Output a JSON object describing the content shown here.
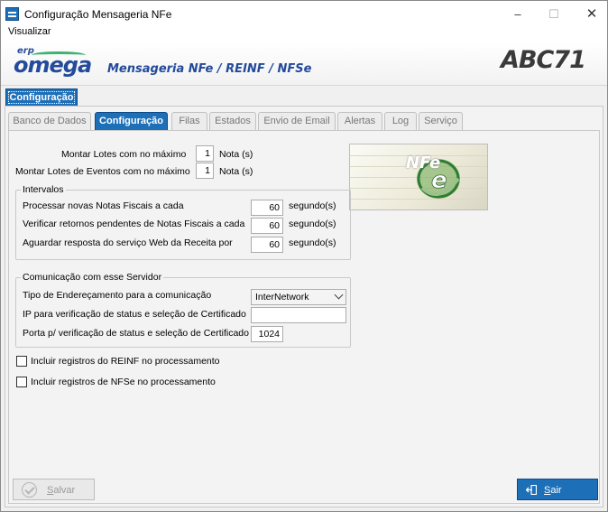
{
  "window": {
    "title": "Configuração Mensageria NFe",
    "controls": {
      "minimize": "–",
      "maximize": "☐",
      "close": "✕"
    }
  },
  "menu": {
    "items": [
      "Visualizar"
    ]
  },
  "banner": {
    "logo_prefix": "erp",
    "logo_name": "omega",
    "title": "Mensageria NFe / REINF / NFSe",
    "brand": "ABC71"
  },
  "outer_tab": {
    "label": "Configuração"
  },
  "tabs": [
    {
      "label": "Banco de Dados",
      "active": false
    },
    {
      "label": "Configuração",
      "active": true
    },
    {
      "label": "Filas",
      "active": false
    },
    {
      "label": "Estados",
      "active": false
    },
    {
      "label": "Envio de Email",
      "active": false
    },
    {
      "label": "Alertas",
      "active": false
    },
    {
      "label": "Log",
      "active": false
    },
    {
      "label": "Serviço",
      "active": false
    }
  ],
  "lotes": {
    "max_lotes_label": "Montar Lotes com no máximo",
    "max_lotes_value": "1",
    "max_lotes_unit": "Nota (s)",
    "max_lotes_eventos_label": "Montar Lotes de Eventos com no máximo",
    "max_lotes_eventos_value": "1",
    "max_lotes_eventos_unit": "Nota (s)"
  },
  "intervalos": {
    "title": "Intervalos",
    "rows": [
      {
        "label": "Processar novas Notas Fiscais a cada",
        "value": "60",
        "unit": "segundo(s)"
      },
      {
        "label": "Verificar retornos pendentes de Notas Fiscais a cada",
        "value": "60",
        "unit": "segundo(s)"
      },
      {
        "label": "Aguardar resposta do serviço Web da Receita por",
        "value": "60",
        "unit": "segundo(s)"
      }
    ]
  },
  "comunicacao": {
    "title": "Comunicação com esse Servidor",
    "tipo_label": "Tipo de Endereçamento para a comunicação",
    "tipo_value": "InterNetwork",
    "ip_label": "IP para verificação de status e seleção de Certificado",
    "ip_value": "",
    "porta_label": "Porta p/ verificação de status e seleção de Certificado",
    "porta_value": "1024"
  },
  "options": {
    "reinf_label": "Incluir registros do REINF no processamento",
    "reinf_checked": false,
    "nfse_label": "Incluir registros de NFSe no processamento",
    "nfse_checked": false
  },
  "nfe_image": {
    "text": "NFe"
  },
  "buttons": {
    "salvar_prefix": "S",
    "salvar_rest": "alvar",
    "salvar_enabled": false,
    "sair_prefix": "S",
    "sair_rest": "air"
  },
  "colors": {
    "accent": "#1d6fb8",
    "brand_blue": "#234a9b"
  },
  "icons": {
    "app": "app-icon",
    "salvar": "checkmark-circle-icon",
    "sair": "exit-icon",
    "dropdown": "chevron-down-icon"
  }
}
